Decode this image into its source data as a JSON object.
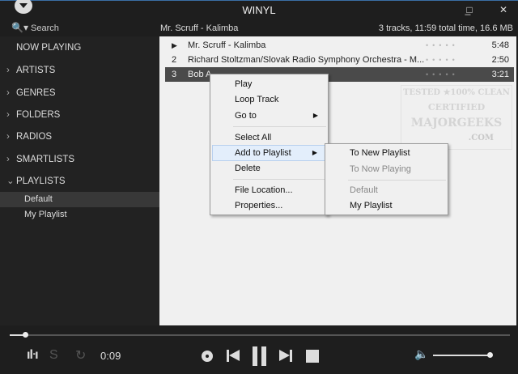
{
  "window": {
    "title": "WINYL",
    "minimize": "_",
    "maximize": "□",
    "close": "✕"
  },
  "search": {
    "label": "Search",
    "icon": "search-icon"
  },
  "now_playing_info": "Mr. Scruff - Kalimba",
  "stats": "3 tracks, 11:59 total time, 16.6 MB",
  "sidebar": {
    "items": [
      {
        "label": "NOW PLAYING",
        "chevron": ""
      },
      {
        "label": "ARTISTS",
        "chevron": "›"
      },
      {
        "label": "GENRES",
        "chevron": "›"
      },
      {
        "label": "FOLDERS",
        "chevron": "›"
      },
      {
        "label": "RADIOS",
        "chevron": "›"
      },
      {
        "label": "SMARTLISTS",
        "chevron": "›"
      },
      {
        "label": "PLAYLISTS",
        "chevron": "⌄"
      }
    ],
    "playlists": [
      "Default",
      "My Playlist"
    ]
  },
  "tracks": [
    {
      "num": "▶",
      "name": "Mr. Scruff - Kalimba",
      "rating": "•••••",
      "duration": "5:48"
    },
    {
      "num": "2",
      "name": "Richard Stoltzman/Slovak Radio Symphony Orchestra - M...",
      "rating": "•••••",
      "duration": "2:50"
    },
    {
      "num": "3",
      "name": "Bob A",
      "rating": "•••••",
      "duration": "3:21"
    }
  ],
  "context_menu": {
    "items": [
      "Play",
      "Loop Track",
      "Go to",
      "Select All",
      "Add to Playlist",
      "Delete",
      "File Location...",
      "Properties..."
    ],
    "arrow": "▶"
  },
  "submenu": {
    "items": [
      "To New Playlist",
      "To Now Playing",
      "Default",
      "My Playlist"
    ]
  },
  "watermark": {
    "lines": [
      "TESTED ★100% CLEAN",
      "CERTIFIED",
      "MAJORGEEKS",
      ".COM"
    ]
  },
  "player": {
    "elapsed": "0:09",
    "progress": 0.02,
    "volume": 1.0
  }
}
